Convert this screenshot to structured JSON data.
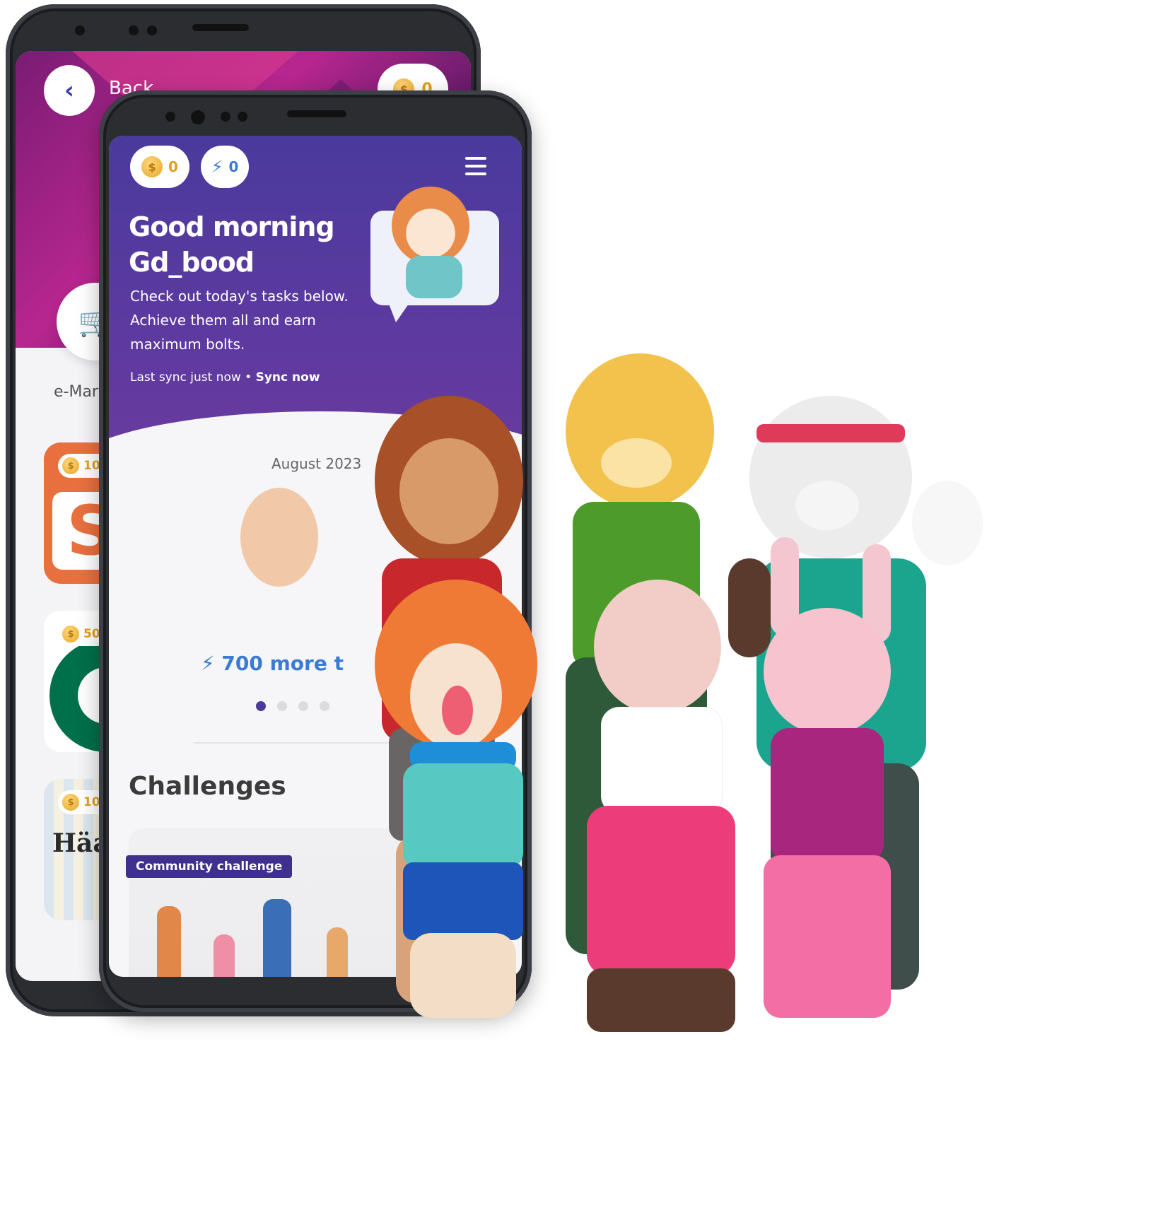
{
  "back_screen": {
    "back_label": "Back",
    "coin_balance": "0",
    "store_item_label": "e-Mart",
    "reward_tiles": [
      {
        "coins": "100",
        "logo_text": "S"
      },
      {
        "coins": "50",
        "logo_text": ""
      },
      {
        "coins": "100",
        "logo_text": "Häag"
      }
    ]
  },
  "front_screen": {
    "coin_balance": "0",
    "bolt_balance": "0",
    "greeting": "Good morning Gd_bood",
    "subtext": "Check out today's tasks below. Achieve them all and earn maximum bolts.",
    "sync_status": "Last sync just now",
    "sync_action": "Sync now",
    "month": "August 2023",
    "bolts_progress": "700 more t",
    "section_title": "Challenges",
    "challenge_tag": "Community challenge"
  },
  "colors": {
    "header_purple": "#4a3a9c",
    "back_header_magenta": "#b8268f",
    "coin_gold": "#e0a020",
    "bolt_blue": "#3a7bd5"
  },
  "icons": [
    "back-arrow-icon",
    "coin-icon",
    "bolt-icon",
    "menu-icon",
    "shopping-cart-icon"
  ]
}
